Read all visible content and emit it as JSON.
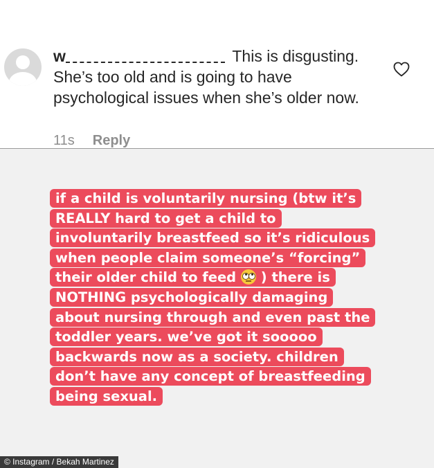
{
  "comment": {
    "username_visible": "w",
    "text": "This is disgusting. She’s too old and is going to have psychological issues when she’s older now.",
    "time": "11s",
    "reply_label": "Reply"
  },
  "icons": {
    "like": "heart-outline-icon",
    "avatar": "default-user-avatar-icon",
    "emoji": "face-with-rolling-eyes-emoji"
  },
  "story": {
    "text_part1": "if a child is voluntarily nursing (btw it’s REALLY hard to get a child to involuntarily breastfeed so it’s ridiculous when people claim someone’s “forcing” their older child to feed",
    "text_part2": ") there is NOTHING psychologically damaging about nursing through and even past the toddler years. we’ve got it sooooo backwards now as a society. children don’t have any concept of breastfeeding being sexual.",
    "highlight_color": "#ec4b5c",
    "background_color": "#f1f1f1"
  },
  "credit": "© Instagram / Bekah Martinez"
}
